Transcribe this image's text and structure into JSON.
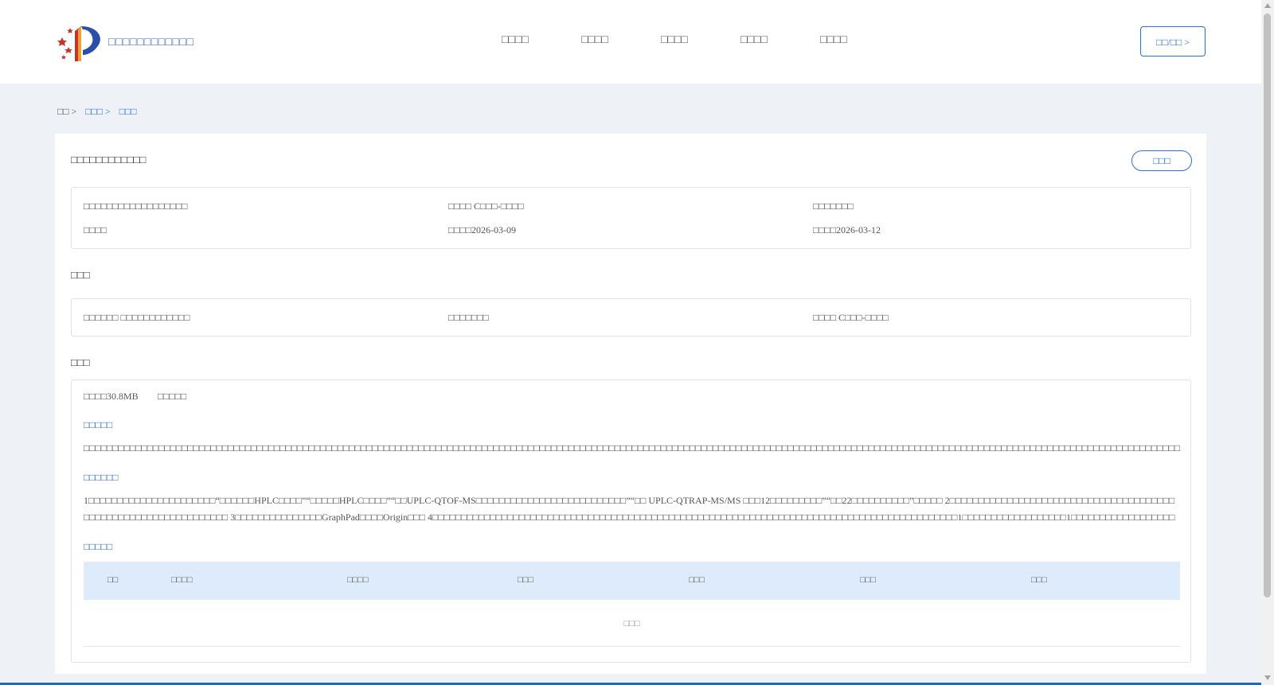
{
  "header": {
    "brand": "□□□□□□□□□□□□",
    "nav": [
      "□□□□",
      "□□□□",
      "□□□□",
      "□□□□",
      "□□□□"
    ],
    "login_label": "□□/□□ >"
  },
  "breadcrumb": [
    "□□ >",
    "□□□ >",
    "□□□"
  ],
  "detail": {
    "title": "□□□□□□□□□□□□",
    "apply_label": "□□□",
    "info": {
      "r1c1": "□□□□□□□□□□□□□□□□□□",
      "r1c2": "□□□□ C□□□-□□□□",
      "r1c3": "□□□□□□□",
      "r2c1": "□□□□",
      "r2c2": "□□□□2026-03-09",
      "r2c3": "□□□□2026-03-12"
    },
    "section2_label": "□□□",
    "section2": {
      "c1": "□□□□□□ □□□□□□□□□□□□",
      "c2": "□□□□□□□",
      "c3": "□□□□ C□□□-□□□□"
    },
    "section3_label": "□□□",
    "file": {
      "size": "□□□□30.8MB",
      "extra": "□□□□□"
    },
    "sub1_title": "□□□□□",
    "sub1_text": "□□□□□□□□□□□□□□□□□□□□□□□□□□□□□□□□□□□□□□□□□□□□□□□□□□□□□□□□□□□□□□□□□□□□□□□□□□□□□□□□□□□□□□□□□□□□□□□□□□□□□□□□□□□□□□□□□□□□□□□□□□□□□□□□□□□□□□□□□□□□□□□□□□□□□□□□□□□□□□□□□□□□□□□□□□□□□□□□□□□□□□□□□□□□□□□□□□□□□□□□□□",
    "sub2_title": "□□□□□□",
    "sub2_text": "1□□□□□□□□□□□□□□□□□□□□□□“□□□□□□HPLC□□□□”“□□□□□HPLC□□□□”“□□UPLC-QTOF-MS□□□□□□□□□□□□□□□□□□□□□□□□□□”“□□ UPLC-QTRAP-MS/MS □□□12□□□□□□□□□”“□□22□□□□□□□□□□”□□□□□ 2□□□□□□□□□□□□□□□□□□□□□□□□□□□□□□□□□□□□□□□□□□□□□□□□□□□□□□□□□□□□□□□□ 3□□□□□□□□□□□□□□□GraphPad□□□□Origin□□□ 4□□□□□□□□□□□□□□□□□□□□□□□□□□□□□□□□□□□□□□□□□□□□□□□□□□□□□□□□□□□□□□□□□□□□□□□□□□□□□□□□□□□□□□□□□□□1□□□□□□□□□□□□□□□□□□1□□□□□□□□□□□□□□□□□□",
    "sub3_title": "□□□□□",
    "table_headers": [
      "□□",
      "□□□□",
      "□□□□",
      "□□□",
      "□□□",
      "□□□",
      "□□□"
    ],
    "table_empty": "□□□"
  },
  "colors": {
    "accent": "#2d6fd6",
    "table_header_bg": "#deebfa",
    "page_bg": "#eef2f6",
    "footer": "#2a67b1"
  }
}
